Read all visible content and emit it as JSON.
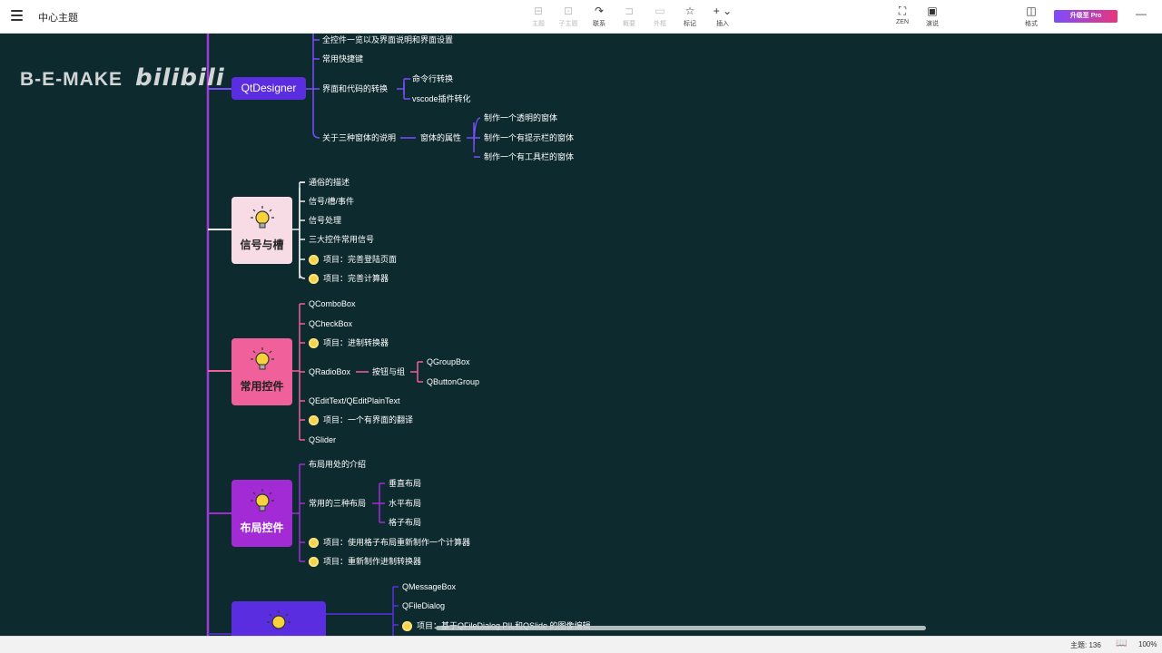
{
  "app": {
    "title": "中心主题",
    "upgrade_label": "升级至 Pro"
  },
  "toolbar": [
    {
      "icon": "topic-icon",
      "label": "主题",
      "enabled": false
    },
    {
      "icon": "subtopic-icon",
      "label": "子主题",
      "enabled": false
    },
    {
      "icon": "relation-icon",
      "label": "联系",
      "enabled": true
    },
    {
      "icon": "summary-icon",
      "label": "概要",
      "enabled": false
    },
    {
      "icon": "boundary-icon",
      "label": "外框",
      "enabled": false
    },
    {
      "icon": "star-icon",
      "label": "标记",
      "enabled": true
    },
    {
      "icon": "plus-icon",
      "label": "插入",
      "enabled": true
    }
  ],
  "toolbar_right": [
    {
      "icon": "zen-icon",
      "label": "ZEN"
    },
    {
      "icon": "present-icon",
      "label": "演说"
    },
    {
      "icon": "format-icon",
      "label": "格式"
    }
  ],
  "watermark": {
    "brand": "B-E-MAKE",
    "logo": "bilibili"
  },
  "mindmap": {
    "qtdesigner": {
      "label": "QtDesigner",
      "children": [
        "全控件一览以及界面说明和界面设置",
        "常用快捷键",
        "界面和代码的转换",
        "关于三种窗体的说明"
      ],
      "convert": [
        "命令行转换",
        "vscode插件转化"
      ],
      "window_attr": "窗体的属性",
      "window_types": [
        "制作一个透明的窗体",
        "制作一个有提示栏的窗体",
        "制作一个有工具栏的窗体"
      ]
    },
    "signals": {
      "label": "信号与槽",
      "children": [
        "通俗的描述",
        "信号/槽/事件",
        "信号处理",
        "三大控件常用信号",
        "项目：完善登陆页面",
        "项目：完善计算器"
      ]
    },
    "controls": {
      "label": "常用控件",
      "children": [
        "QComboBox",
        "QCheckBox",
        "项目：进制转换器",
        "QRadioBox",
        "QEditText/QEditPlainText",
        "项目：一个有界面的翻译",
        "QSlider"
      ],
      "button_group": "按钮与组",
      "groups": [
        "QGroupBox",
        "QButtonGroup"
      ]
    },
    "layout": {
      "label": "布局控件",
      "children": [
        "布局用处的介绍",
        "常用的三种布局",
        "项目：使用格子布局重新制作一个计算器",
        "项目：重新制作进制转换器"
      ],
      "layouts": [
        "垂直布局",
        "水平布局",
        "格子布局"
      ]
    },
    "dialogs": {
      "children": [
        "QMessageBox",
        "QFileDialog",
        "项目：基于QFileDialog PIL和QSlide 的图像编辑"
      ]
    }
  },
  "colors": {
    "canvas": "#0d2a2f",
    "trunk": "#9b3dd6",
    "qtdesigner": "#5b2de0",
    "signals": "#f7dce6",
    "controls": "#f0609a",
    "layout": "#a32bd6",
    "dialogs": "#5b2de0"
  },
  "status": {
    "topic_count": "主题: 136",
    "zoom": "100%"
  }
}
